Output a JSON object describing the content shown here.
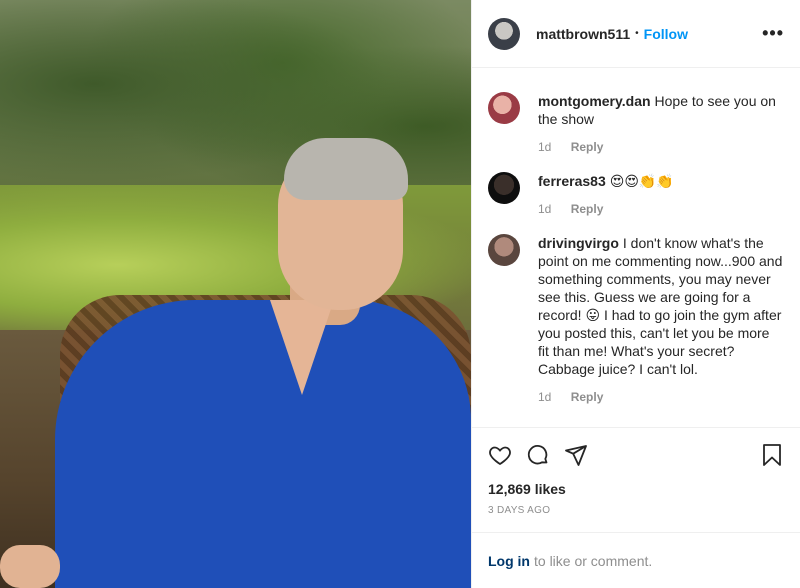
{
  "post": {
    "author": "mattbrown511",
    "dot": "•",
    "follow_label": "Follow",
    "more_label": "•••"
  },
  "comments": [
    {
      "username": "montgomery.dan",
      "text": "Hope to see you on the show",
      "age": "1d",
      "reply_label": "Reply"
    },
    {
      "username": "ferreras83",
      "text": "😍😍👏👏",
      "age": "1d",
      "reply_label": "Reply"
    },
    {
      "username": "drivingvirgo",
      "text": "I don't know what's the point on me commenting now...900 and something comments, you may never see this. Guess we are going for a record! 😛 I had to go join the gym after you posted this, can't let you be more fit than me! What's your secret? Cabbage juice? I can't lol.",
      "age": "1d",
      "reply_label": "Reply"
    }
  ],
  "actions": {
    "like_icon": "heart-icon",
    "comment_icon": "comment-bubble-icon",
    "share_icon": "paper-plane-icon",
    "save_icon": "bookmark-icon"
  },
  "likes": "12,869 likes",
  "date": "3 DAYS AGO",
  "login": {
    "link": "Log in",
    "text": "to like or comment."
  },
  "colors": {
    "link_blue": "#0095f6",
    "text": "#262626",
    "muted": "#8e8e8e"
  }
}
